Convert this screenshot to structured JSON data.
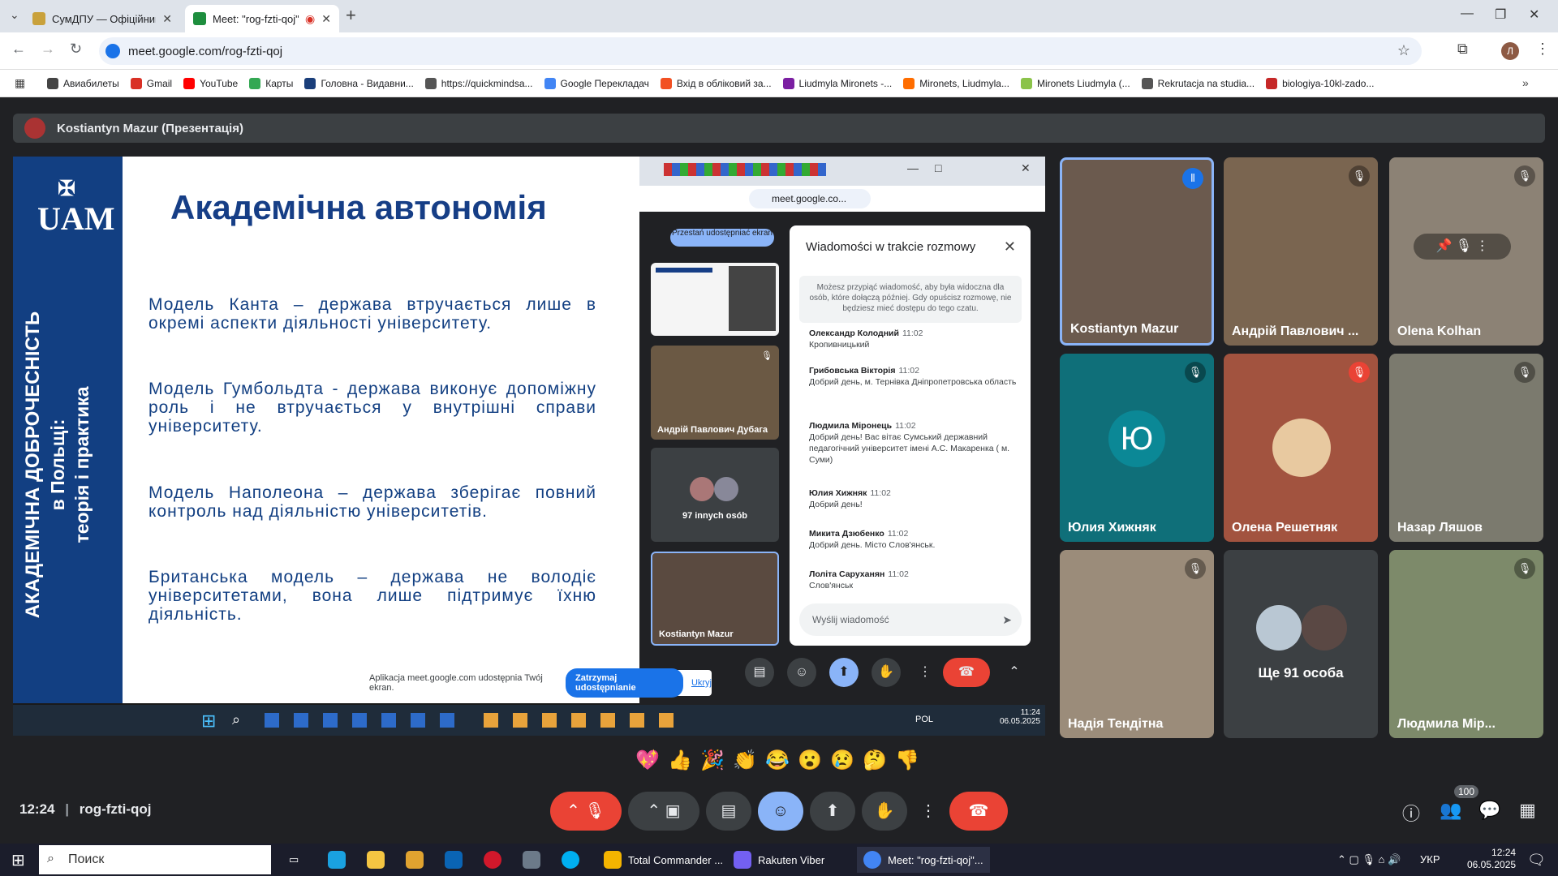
{
  "browser": {
    "tabs": [
      {
        "label": "СумДПУ — Офіційний сайт Су",
        "color": "#c9a13b"
      },
      {
        "label": "Meet: \"rog-fzti-qoj\"",
        "color": "#1e8e3e"
      }
    ],
    "url": "meet.google.com/rog-fzti-qoj",
    "bookmarks": [
      {
        "label": "Авиабилеты",
        "color": "#444"
      },
      {
        "label": "Gmail",
        "color": "#d93025"
      },
      {
        "label": "YouTube",
        "color": "#ff0000"
      },
      {
        "label": "Карты",
        "color": "#34a853"
      },
      {
        "label": "Головна - Видавни...",
        "color": "#1a3e7a"
      },
      {
        "label": "https://quickmindsa...",
        "color": "#555"
      },
      {
        "label": "Google Перекладач",
        "color": "#4285f4"
      },
      {
        "label": "Вхід в обліковий за...",
        "color": "#f25022"
      },
      {
        "label": "Liudmyla Mironets -...",
        "color": "#7b1fa2"
      },
      {
        "label": "Mironets, Liudmyla...",
        "color": "#ff6d00"
      },
      {
        "label": "Mironets Liudmyla (...",
        "color": "#8bc34a"
      },
      {
        "label": "Rekrutacja na studia...",
        "color": "#555"
      },
      {
        "label": "biologiya-10kl-zado...",
        "color": "#c62828"
      }
    ]
  },
  "meet": {
    "presenter": "Kostiantyn Mazur (Презентація)",
    "meeting_time": "12:24",
    "meeting_code": "rog-fzti-qoj",
    "participants_count": "100",
    "slide": {
      "title": "Академічна автономія",
      "paragraphs": [
        "Модель Канта – держава втручається лише в окремі аспекти діяльності університету.",
        "Модель Гумбольдта - держава виконує допоміжну роль і не втручається у внутрішні справи університету.",
        "Модель Наполеона – держава зберігає повний контроль над діяльністю університетів.",
        "Британська модель – держава не володіє університетами, вона лише підтримує їхню діяльність."
      ],
      "logo": "UAM",
      "vertical_1": "АКАДЕМІЧНА ДОБРОЧЕСНІСТЬ",
      "vertical_2": "в Польщі:",
      "vertical_3": "теорія і практика"
    },
    "inner": {
      "url": "meet.google.co...",
      "stop_btn": "Przestań udostępniać ekran",
      "tile_andriy": "Андрій Павлович Дубага",
      "tile_others": "97 innych osób",
      "tile_kostiantyn": "Kostiantyn Mazur",
      "chat_title": "Wiadomości w trakcie rozmowy",
      "chat_note": "Możesz przypiąć wiadomość, aby była widoczna dla osób, które dołączą później. Gdy opuścisz rozmowę, nie będziesz mieć dostępu do tego czatu.",
      "messages": [
        {
          "who": "Олександр Колодний",
          "time": "11:02",
          "text": "Кропивницький"
        },
        {
          "who": "Грибовська Вікторія",
          "time": "11:02",
          "text": "Добрий день, м. Тернівка Дніпропетровська область"
        },
        {
          "who": "Людмила Міронець",
          "time": "11:02",
          "text": "Добрий день! Вас вітає Сумський державний педагогічний університет імені А.С. Макаренка ( м. Суми)"
        },
        {
          "who": "Юлия Хижняк",
          "time": "11:02",
          "text": "Добрий день!"
        },
        {
          "who": "Микита Дзюбенко",
          "time": "11:02",
          "text": "Добрий день. Місто Слов'янськ."
        },
        {
          "who": "Лоліта Саруханян",
          "time": "11:02",
          "text": "Слов'янськ"
        }
      ],
      "chat_placeholder": "Wyślij wiadomość",
      "share_banner": "Aplikacja meet.google.com udostępnia Twój ekran.",
      "share_stop": "Zatrzymaj udostępnianie",
      "share_hide": "Ukryj",
      "taskbar_time": "11:24",
      "taskbar_date": "06.05.2025",
      "taskbar_lang": "POL"
    },
    "participants": [
      {
        "name": "Kostiantyn Mazur",
        "bg": "#6b5a4e"
      },
      {
        "name": "Андрій Павлович ...",
        "bg": "#7a6550"
      },
      {
        "name": "Olena Kolhan",
        "bg": "#8c8275"
      },
      {
        "name": "Юлия Хижняк",
        "bg": "#0f6f79",
        "initial": "Ю"
      },
      {
        "name": "Олена Решетняк",
        "bg": "#a2533f"
      },
      {
        "name": "Назар Ляшов",
        "bg": "#7b7a6e"
      },
      {
        "name": "Надія Тендітна",
        "bg": "#9b8c7a"
      },
      {
        "name": "Ще 91 особа",
        "bg": "#3c4043"
      },
      {
        "name": "Людмила Мір...",
        "bg": "#7d8a6a"
      }
    ],
    "reactions": [
      "💖",
      "👍",
      "🎉",
      "👏",
      "😂",
      "😮",
      "😢",
      "🤔",
      "👎"
    ]
  },
  "windows": {
    "search": "Поиск",
    "apps": [
      {
        "label": "Total Commander ...",
        "color": "#f4b400"
      },
      {
        "label": "Rakuten Viber",
        "color": "#7360f2"
      },
      {
        "label": "Meet: \"rog-fzti-qoj\"...",
        "color": "#4285f4"
      }
    ],
    "lang": "УКР",
    "time": "12:24",
    "date": "06.05.2025"
  }
}
